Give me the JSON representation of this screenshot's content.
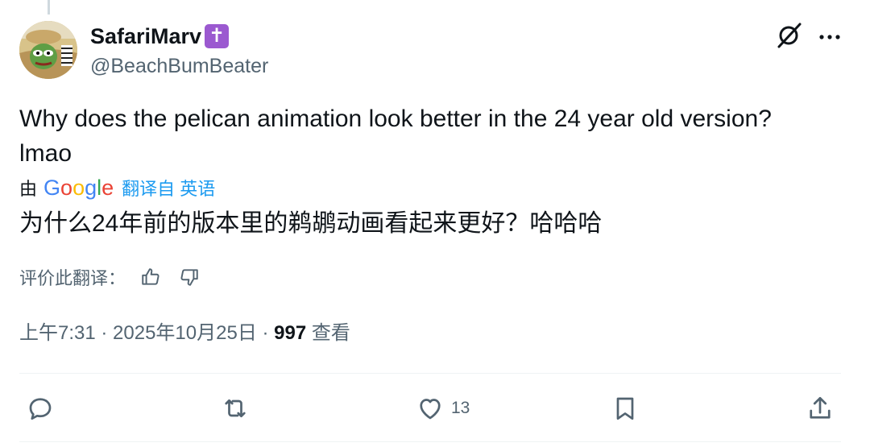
{
  "author": {
    "display_name": "SafariMarv",
    "badge_glyph": "✝",
    "handle": "@BeachBumBeater"
  },
  "tweet": {
    "text_line1": "Why does the pelican animation look better in the 24 year old version?",
    "text_line2": "lmao"
  },
  "translation": {
    "prefix": "由",
    "provider": "Google",
    "link_label": "翻译自 英语",
    "text": "为什么24年前的版本里的鹈鹕动画看起来更好？哈哈哈"
  },
  "rating": {
    "label": "评价此翻译："
  },
  "meta": {
    "timestamp": "上午7:31 · 2025年10月25日 · ",
    "views_count": "997",
    "views_label": " 查看"
  },
  "actions": {
    "reply_count": "",
    "retweet_count": "",
    "like_count": "13"
  },
  "colors": {
    "text_primary": "#0f1419",
    "text_secondary": "#536471",
    "link": "#1d9bf0",
    "divider": "#eff3f4",
    "badge": "#9b59d0"
  }
}
